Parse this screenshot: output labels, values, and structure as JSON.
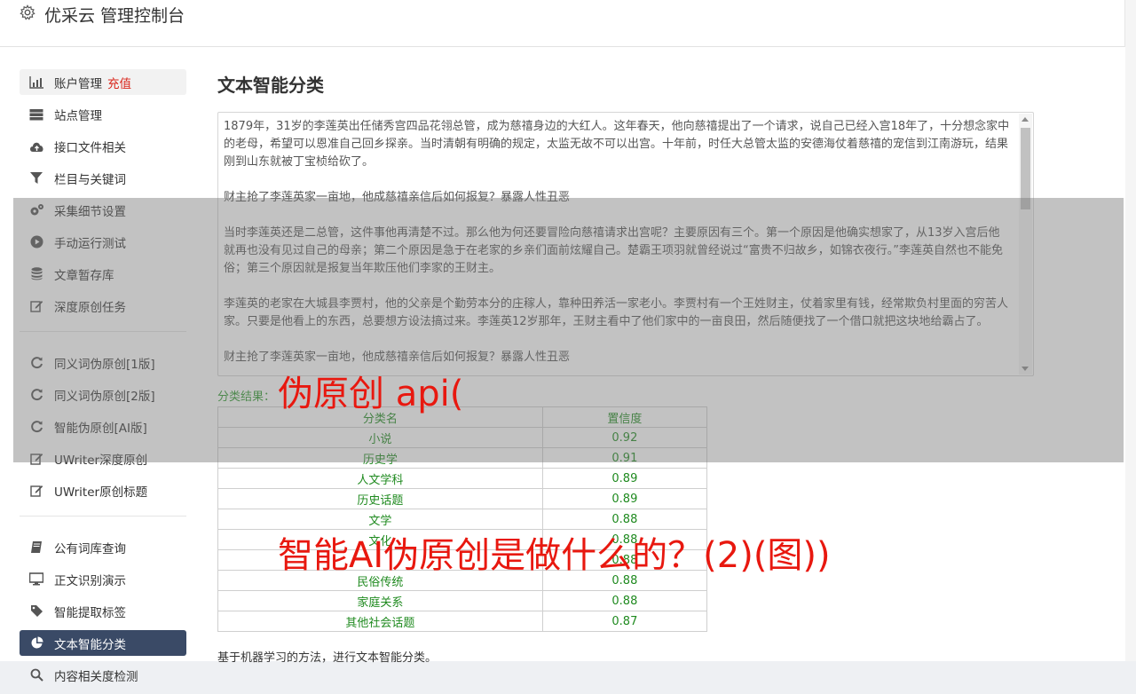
{
  "header": {
    "title": "优采云 管理控制台"
  },
  "sidebar": {
    "groups": [
      [
        {
          "label": "账户管理",
          "extra": "充值",
          "icon": "bar-chart-icon"
        },
        {
          "label": "站点管理",
          "icon": "server-icon"
        },
        {
          "label": "接口文件相关",
          "icon": "cloud-upload-icon"
        },
        {
          "label": "栏目与关键词",
          "icon": "filter-icon"
        },
        {
          "label": "采集细节设置",
          "icon": "gears-icon"
        },
        {
          "label": "手动运行测试",
          "icon": "play-circle-icon"
        },
        {
          "label": "文章暂存库",
          "icon": "database-icon"
        },
        {
          "label": "深度原创任务",
          "icon": "edit-icon"
        }
      ],
      [
        {
          "label": "同义词伪原创[1版]",
          "icon": "refresh-icon"
        },
        {
          "label": "同义词伪原创[2版]",
          "icon": "refresh-icon"
        },
        {
          "label": "智能伪原创[AI版]",
          "icon": "refresh-icon"
        },
        {
          "label": "UWriter深度原创",
          "icon": "edit-icon"
        },
        {
          "label": "UWriter原创标题",
          "icon": "edit-icon"
        }
      ],
      [
        {
          "label": "公有词库查询",
          "icon": "book-icon"
        },
        {
          "label": "正文识别演示",
          "icon": "monitor-icon"
        },
        {
          "label": "智能提取标签",
          "icon": "tag-icon"
        },
        {
          "label": "文本智能分类",
          "icon": "pie-chart-icon"
        },
        {
          "label": "内容相关度检测",
          "icon": "search-icon"
        }
      ]
    ]
  },
  "main": {
    "title": "文本智能分类",
    "paragraphs": [
      "1879年，31岁的李莲英出任储秀宫四品花翎总管，成为慈禧身边的大红人。这年春天，他向慈禧提出了一个请求，说自己已经入宫18年了，十分想念家中的老母，希望可以恩准自己回乡探亲。当时清朝有明确的规定，太监无故不可以出宫。十年前，时任大总管太监的安德海仗着慈禧的宠信到江南游玩，结果刚到山东就被丁宝桢给砍了。",
      "财主抢了李莲英家一亩地，他成慈禧亲信后如何报复？暴露人性丑恶",
      "当时李莲英还是二总管，这件事他再清楚不过。那么他为何还要冒险向慈禧请求出宫呢？主要原因有三个。第一个原因是他确实想家了，从13岁入宫后他就再也没有见过自己的母亲；第二个原因是急于在老家的乡亲们面前炫耀自己。楚霸王项羽就曾经说过“富贵不归故乡，如锦衣夜行。”李莲英自然也不能免俗；第三个原因就是报复当年欺压他们李家的王财主。",
      "李莲英的老家在大城县李贾村，他的父亲是个勤劳本分的庄稼人，靠种田养活一家老小。李贾村有一个王姓财主，仗着家里有钱，经常欺负村里面的穷苦人家。只要是他看上的东西，总要想方设法搞过来。李莲英12岁那年，王财主看中了他们家中的一亩良田，然后随便找了一个借口就把这块地给霸占了。",
      "财主抢了李莲英家一亩地，他成慈禧亲信后如何报复？暴露人性丑恶"
    ],
    "result_label": "分类结果：",
    "table": {
      "headers": [
        "分类名",
        "置信度"
      ],
      "rows": [
        [
          "小说",
          "0.92"
        ],
        [
          "历史学",
          "0.91"
        ],
        [
          "人文学科",
          "0.89"
        ],
        [
          "历史话题",
          "0.89"
        ],
        [
          "文学",
          "0.88"
        ],
        [
          "文化",
          "0.88"
        ],
        [
          "",
          "0.88"
        ],
        [
          "民俗传统",
          "0.88"
        ],
        [
          "家庭关系",
          "0.88"
        ],
        [
          "其他社会话题",
          "0.87"
        ]
      ]
    },
    "footer_note": "基于机器学习的方法，进行文本智能分类。"
  },
  "watermarks": [
    "伪原创 api(",
    "智能AI伪原创是做什么的？(2)(图))"
  ],
  "colors": {
    "accent_active": "#3a4a66",
    "recharge": "#d9261c",
    "result_green": "#1f8a1f",
    "watermark_red": "#e8180f"
  }
}
